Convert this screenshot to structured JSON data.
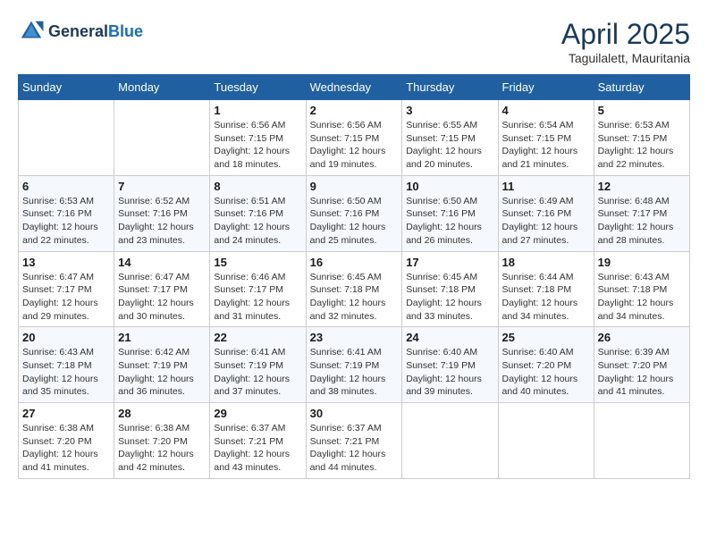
{
  "header": {
    "logo_general": "General",
    "logo_blue": "Blue",
    "title": "April 2025",
    "location": "Taguilalett, Mauritania"
  },
  "weekdays": [
    "Sunday",
    "Monday",
    "Tuesday",
    "Wednesday",
    "Thursday",
    "Friday",
    "Saturday"
  ],
  "weeks": [
    [
      {
        "day": "",
        "info": ""
      },
      {
        "day": "",
        "info": ""
      },
      {
        "day": "1",
        "info": "Sunrise: 6:56 AM\nSunset: 7:15 PM\nDaylight: 12 hours and 18 minutes."
      },
      {
        "day": "2",
        "info": "Sunrise: 6:56 AM\nSunset: 7:15 PM\nDaylight: 12 hours and 19 minutes."
      },
      {
        "day": "3",
        "info": "Sunrise: 6:55 AM\nSunset: 7:15 PM\nDaylight: 12 hours and 20 minutes."
      },
      {
        "day": "4",
        "info": "Sunrise: 6:54 AM\nSunset: 7:15 PM\nDaylight: 12 hours and 21 minutes."
      },
      {
        "day": "5",
        "info": "Sunrise: 6:53 AM\nSunset: 7:15 PM\nDaylight: 12 hours and 22 minutes."
      }
    ],
    [
      {
        "day": "6",
        "info": "Sunrise: 6:53 AM\nSunset: 7:16 PM\nDaylight: 12 hours and 22 minutes."
      },
      {
        "day": "7",
        "info": "Sunrise: 6:52 AM\nSunset: 7:16 PM\nDaylight: 12 hours and 23 minutes."
      },
      {
        "day": "8",
        "info": "Sunrise: 6:51 AM\nSunset: 7:16 PM\nDaylight: 12 hours and 24 minutes."
      },
      {
        "day": "9",
        "info": "Sunrise: 6:50 AM\nSunset: 7:16 PM\nDaylight: 12 hours and 25 minutes."
      },
      {
        "day": "10",
        "info": "Sunrise: 6:50 AM\nSunset: 7:16 PM\nDaylight: 12 hours and 26 minutes."
      },
      {
        "day": "11",
        "info": "Sunrise: 6:49 AM\nSunset: 7:16 PM\nDaylight: 12 hours and 27 minutes."
      },
      {
        "day": "12",
        "info": "Sunrise: 6:48 AM\nSunset: 7:17 PM\nDaylight: 12 hours and 28 minutes."
      }
    ],
    [
      {
        "day": "13",
        "info": "Sunrise: 6:47 AM\nSunset: 7:17 PM\nDaylight: 12 hours and 29 minutes."
      },
      {
        "day": "14",
        "info": "Sunrise: 6:47 AM\nSunset: 7:17 PM\nDaylight: 12 hours and 30 minutes."
      },
      {
        "day": "15",
        "info": "Sunrise: 6:46 AM\nSunset: 7:17 PM\nDaylight: 12 hours and 31 minutes."
      },
      {
        "day": "16",
        "info": "Sunrise: 6:45 AM\nSunset: 7:18 PM\nDaylight: 12 hours and 32 minutes."
      },
      {
        "day": "17",
        "info": "Sunrise: 6:45 AM\nSunset: 7:18 PM\nDaylight: 12 hours and 33 minutes."
      },
      {
        "day": "18",
        "info": "Sunrise: 6:44 AM\nSunset: 7:18 PM\nDaylight: 12 hours and 34 minutes."
      },
      {
        "day": "19",
        "info": "Sunrise: 6:43 AM\nSunset: 7:18 PM\nDaylight: 12 hours and 34 minutes."
      }
    ],
    [
      {
        "day": "20",
        "info": "Sunrise: 6:43 AM\nSunset: 7:18 PM\nDaylight: 12 hours and 35 minutes."
      },
      {
        "day": "21",
        "info": "Sunrise: 6:42 AM\nSunset: 7:19 PM\nDaylight: 12 hours and 36 minutes."
      },
      {
        "day": "22",
        "info": "Sunrise: 6:41 AM\nSunset: 7:19 PM\nDaylight: 12 hours and 37 minutes."
      },
      {
        "day": "23",
        "info": "Sunrise: 6:41 AM\nSunset: 7:19 PM\nDaylight: 12 hours and 38 minutes."
      },
      {
        "day": "24",
        "info": "Sunrise: 6:40 AM\nSunset: 7:19 PM\nDaylight: 12 hours and 39 minutes."
      },
      {
        "day": "25",
        "info": "Sunrise: 6:40 AM\nSunset: 7:20 PM\nDaylight: 12 hours and 40 minutes."
      },
      {
        "day": "26",
        "info": "Sunrise: 6:39 AM\nSunset: 7:20 PM\nDaylight: 12 hours and 41 minutes."
      }
    ],
    [
      {
        "day": "27",
        "info": "Sunrise: 6:38 AM\nSunset: 7:20 PM\nDaylight: 12 hours and 41 minutes."
      },
      {
        "day": "28",
        "info": "Sunrise: 6:38 AM\nSunset: 7:20 PM\nDaylight: 12 hours and 42 minutes."
      },
      {
        "day": "29",
        "info": "Sunrise: 6:37 AM\nSunset: 7:21 PM\nDaylight: 12 hours and 43 minutes."
      },
      {
        "day": "30",
        "info": "Sunrise: 6:37 AM\nSunset: 7:21 PM\nDaylight: 12 hours and 44 minutes."
      },
      {
        "day": "",
        "info": ""
      },
      {
        "day": "",
        "info": ""
      },
      {
        "day": "",
        "info": ""
      }
    ]
  ]
}
